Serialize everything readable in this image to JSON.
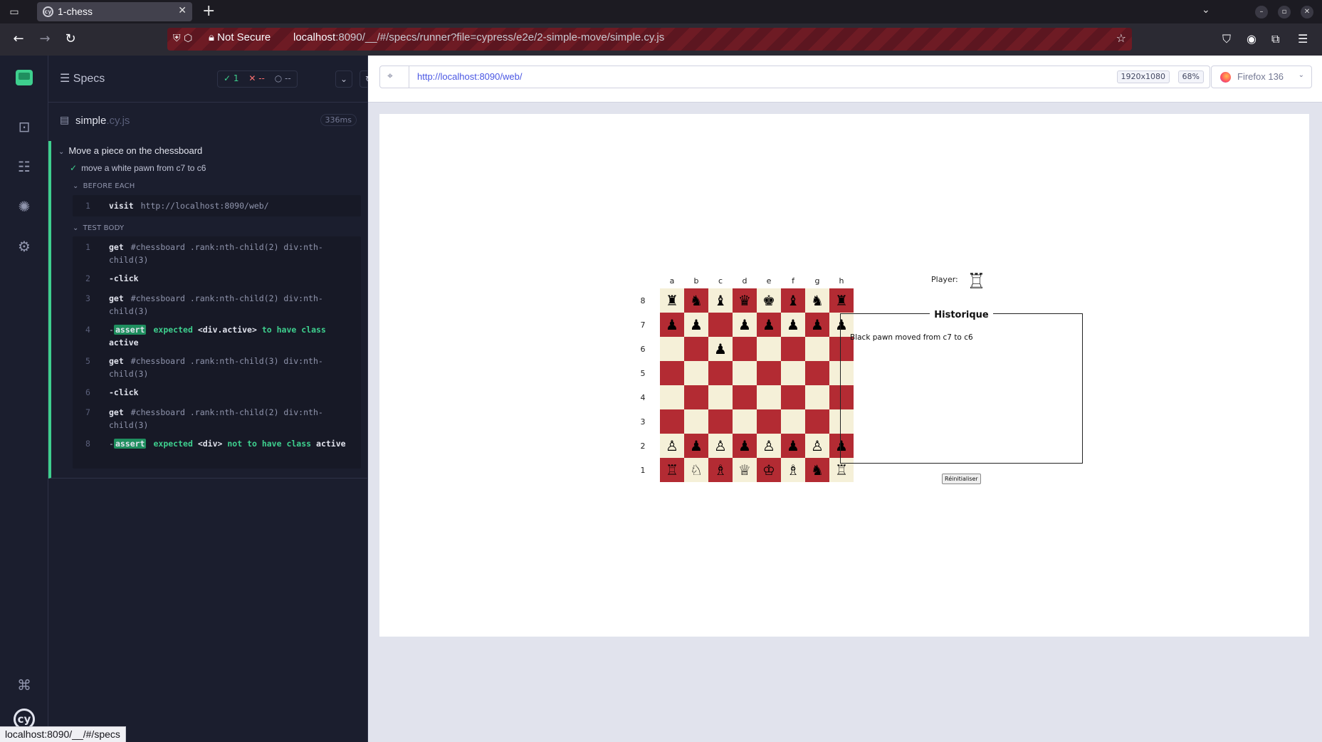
{
  "browser": {
    "tab_title": "1-chess",
    "not_secure": "Not Secure",
    "url_host": "localhost",
    "url_rest": ":8090/__/#/specs/runner?file=cypress/e2e/2-simple-move/simple.cy.js",
    "status_url": "localhost:8090/__/#/specs"
  },
  "reporter": {
    "specs_label": "Specs",
    "passed": "1",
    "failed": "--",
    "pending": "--",
    "spec_name": "simple",
    "spec_ext": ".cy.js",
    "duration": "336ms",
    "suite_title": "Move a piece on the chessboard",
    "test_title": "move a white pawn from c7 to c6",
    "before_each_label": "BEFORE EACH",
    "test_body_label": "TEST BODY",
    "before_each": [
      {
        "num": "1",
        "kw": "visit",
        "arg": "http://localhost:8090/web/"
      }
    ],
    "commands": [
      {
        "num": "2",
        "kw": "-click",
        "arg": ""
      },
      {
        "num": "6",
        "kw": "-click",
        "arg": ""
      }
    ],
    "get_cmds": [
      {
        "num": "1",
        "kw": "get",
        "arg": "#chessboard .rank:nth-child(2) div:nth-child(3)"
      },
      {
        "num": "3",
        "kw": "get",
        "arg": "#chessboard .rank:nth-child(2) div:nth-child(3)"
      },
      {
        "num": "5",
        "kw": "get",
        "arg": "#chessboard .rank:nth-child(3) div:nth-child(3)"
      },
      {
        "num": "7",
        "kw": "get",
        "arg": "#chessboard .rank:nth-child(2) div:nth-child(3)"
      }
    ],
    "asserts": [
      {
        "num": "4",
        "badge": "assert",
        "pre": "expected",
        "el": "<div.active>",
        "post": "to have class",
        "cls": "active"
      },
      {
        "num": "8",
        "badge": "assert",
        "pre": "expected",
        "el": "<div>",
        "post": "not to have class",
        "cls": "active"
      }
    ]
  },
  "aut": {
    "url": "http://localhost:8090/web/",
    "viewport_size": "1920x1080",
    "zoom": "68%",
    "browser": "Firefox 136"
  },
  "chess": {
    "files": [
      "a",
      "b",
      "c",
      "d",
      "e",
      "f",
      "g",
      "h"
    ],
    "ranks": [
      "8",
      "7",
      "6",
      "5",
      "4",
      "3",
      "2",
      "1"
    ],
    "board": [
      [
        "♜",
        "♞",
        "♝",
        "♛",
        "♚",
        "♝",
        "♞",
        "♜"
      ],
      [
        "♟",
        "♟",
        "",
        "♟",
        "♟",
        "♟",
        "♟",
        "♟"
      ],
      [
        "",
        "",
        "♟",
        "",
        "",
        "",
        "",
        ""
      ],
      [
        "",
        "",
        "",
        "",
        "",
        "",
        "",
        ""
      ],
      [
        "",
        "",
        "",
        "",
        "",
        "",
        "",
        ""
      ],
      [
        "",
        "",
        "",
        "",
        "",
        "",
        "",
        ""
      ],
      [
        "♙",
        "♟",
        "♙",
        "♟",
        "♙",
        "♟",
        "♙",
        "♟"
      ],
      [
        "♖",
        "♘",
        "♗",
        "♕",
        "♔",
        "♗",
        "♞",
        "♖"
      ]
    ],
    "player_label": "Player:",
    "player_piece": "♖",
    "history_title": "Historique",
    "history": [
      "Black pawn moved from c7 to c6"
    ],
    "reset_label": "Réinitialiser",
    "light_color": "#f5f0d8",
    "dark_color": "#b32b33"
  }
}
